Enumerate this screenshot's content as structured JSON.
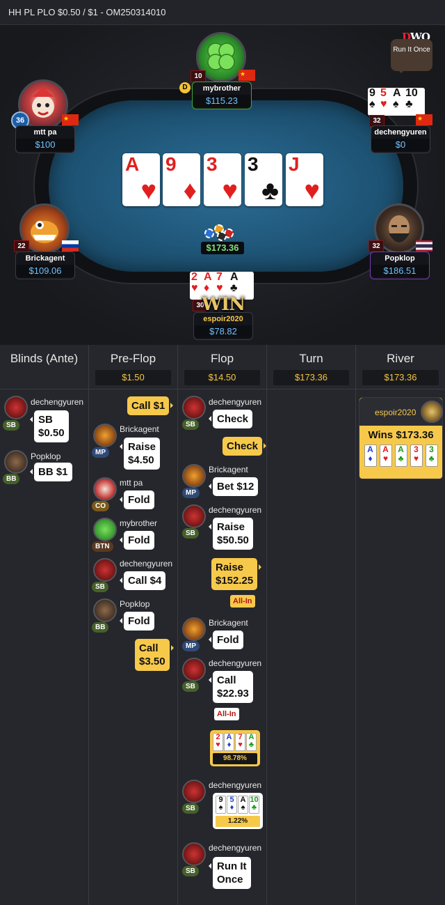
{
  "header": {
    "title": "HH PL PLO $0.50 / $1   - OM250314010"
  },
  "brand": {
    "text1": "D",
    "text2": "WO"
  },
  "run_it_once_bubble": "Run It Once",
  "dealer_button": "D",
  "players": {
    "mybrother": {
      "name": "mybrother",
      "stack": "$115.23",
      "level": "10"
    },
    "mttpa": {
      "name": "mtt pa",
      "stack": "$100",
      "level": "36"
    },
    "dechengyuren": {
      "name": "dechengyuren",
      "stack": "$0",
      "level": "32",
      "cards": [
        {
          "r": "9",
          "s": "♠"
        },
        {
          "r": "5",
          "s": "♥"
        },
        {
          "r": "A",
          "s": "♠"
        },
        {
          "r": "10",
          "s": "♣"
        }
      ]
    },
    "brickagent": {
      "name": "Brickagent",
      "stack": "$109.06",
      "level": "22"
    },
    "popklop": {
      "name": "Popklop",
      "stack": "$186.51",
      "level": "32"
    },
    "espoir": {
      "name": "espoir2020",
      "stack": "$78.82",
      "level": "30",
      "cards": [
        {
          "r": "2",
          "s": "♥"
        },
        {
          "r": "A",
          "s": "♦"
        },
        {
          "r": "7",
          "s": "♥"
        },
        {
          "r": "A",
          "s": "♣"
        }
      ],
      "badge": "WIN"
    }
  },
  "board": [
    {
      "r": "A",
      "s": "♥",
      "color": "#e0201f"
    },
    {
      "r": "9",
      "s": "♦",
      "color": "#e0201f"
    },
    {
      "r": "3",
      "s": "♥",
      "color": "#e0201f"
    },
    {
      "r": "3",
      "s": "♣",
      "color": "#111111"
    },
    {
      "r": "J",
      "s": "♥",
      "color": "#e0201f"
    }
  ],
  "pot": "$173.36",
  "streets": {
    "blinds": {
      "title": "Blinds (Ante)"
    },
    "preflop": {
      "title": "Pre-Flop",
      "pot": "$1.50"
    },
    "flop": {
      "title": "Flop",
      "pot": "$14.50"
    },
    "turn": {
      "title": "Turn",
      "pot": "$173.36"
    },
    "river": {
      "title": "River",
      "pot": "$173.36"
    }
  },
  "actions": {
    "blinds": [
      {
        "player": "dechengyuren",
        "pos": "SB",
        "line1": "SB",
        "line2": "$0.50"
      },
      {
        "player": "Popklop",
        "pos": "BB",
        "line1": "BB  $1"
      }
    ],
    "preflop": [
      {
        "hero": true,
        "line1": "Call  $1"
      },
      {
        "player": "Brickagent",
        "pos": "MP",
        "line1": "Raise",
        "line2": "$4.50"
      },
      {
        "player": "mtt pa",
        "pos": "CO",
        "line1": "Fold"
      },
      {
        "player": "mybrother",
        "pos": "BTN",
        "line1": "Fold"
      },
      {
        "player": "dechengyuren",
        "pos": "SB",
        "line1": "Call  $4"
      },
      {
        "player": "Popklop",
        "pos": "BB",
        "line1": "Fold"
      },
      {
        "hero": true,
        "line1": "Call",
        "line2": "$3.50"
      }
    ],
    "flop": [
      {
        "player": "dechengyuren",
        "pos": "SB",
        "line1": "Check"
      },
      {
        "hero": true,
        "line1": "Check"
      },
      {
        "player": "Brickagent",
        "pos": "MP",
        "line1": "Bet  $12"
      },
      {
        "player": "dechengyuren",
        "pos": "SB",
        "line1": "Raise",
        "line2": "$50.50"
      },
      {
        "hero": true,
        "line1": "Raise",
        "line2": "$152.25",
        "tag": "All-In"
      },
      {
        "player": "Brickagent",
        "pos": "MP",
        "line1": "Fold"
      },
      {
        "player": "dechengyuren",
        "pos": "SB",
        "line1": "Call",
        "line2": "$22.93",
        "tag": "All-In"
      },
      {
        "hero": true,
        "equity": "98.78%",
        "cards": [
          {
            "r": "2",
            "s": "♥"
          },
          {
            "r": "A",
            "s": "♦"
          },
          {
            "r": "7",
            "s": "♥"
          },
          {
            "r": "A",
            "s": "♣"
          }
        ]
      },
      {
        "player": "dechengyuren",
        "pos": "SB",
        "equity": "1.22%",
        "cards": [
          {
            "r": "9",
            "s": "♠"
          },
          {
            "r": "5",
            "s": "♦"
          },
          {
            "r": "A",
            "s": "♠"
          },
          {
            "r": "10",
            "s": "♣"
          }
        ]
      },
      {
        "player": "dechengyuren",
        "pos": "SB",
        "line1": "Run It",
        "line2": "Once"
      }
    ],
    "river": {
      "winner": "espoir2020",
      "wins": "Wins $173.36",
      "cards": [
        {
          "r": "A",
          "s": "♦"
        },
        {
          "r": "A",
          "s": "♥"
        },
        {
          "r": "A",
          "s": "♣"
        },
        {
          "r": "3",
          "s": "♥"
        },
        {
          "r": "3",
          "s": "♣"
        }
      ]
    }
  }
}
